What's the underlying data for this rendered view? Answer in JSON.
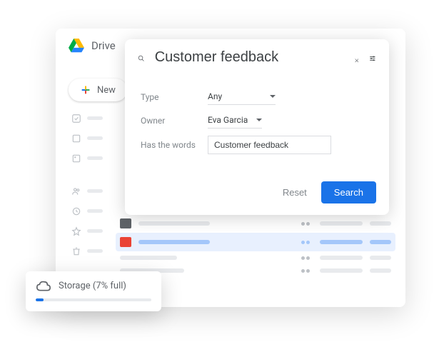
{
  "drive": {
    "title": "Drive"
  },
  "newButton": {
    "label": "New"
  },
  "search": {
    "query": "Customer feedback",
    "filters": {
      "typeLabel": "Type",
      "typeValue": "Any",
      "ownerLabel": "Owner",
      "ownerValue": "Eva Garcia",
      "hasWordsLabel": "Has the words",
      "hasWordsValue": "Customer feedback"
    },
    "resetLabel": "Reset",
    "searchLabel": "Search"
  },
  "storage": {
    "label": "Storage (7% full)",
    "percent": 7
  },
  "colors": {
    "accent": "#1a73e8"
  }
}
